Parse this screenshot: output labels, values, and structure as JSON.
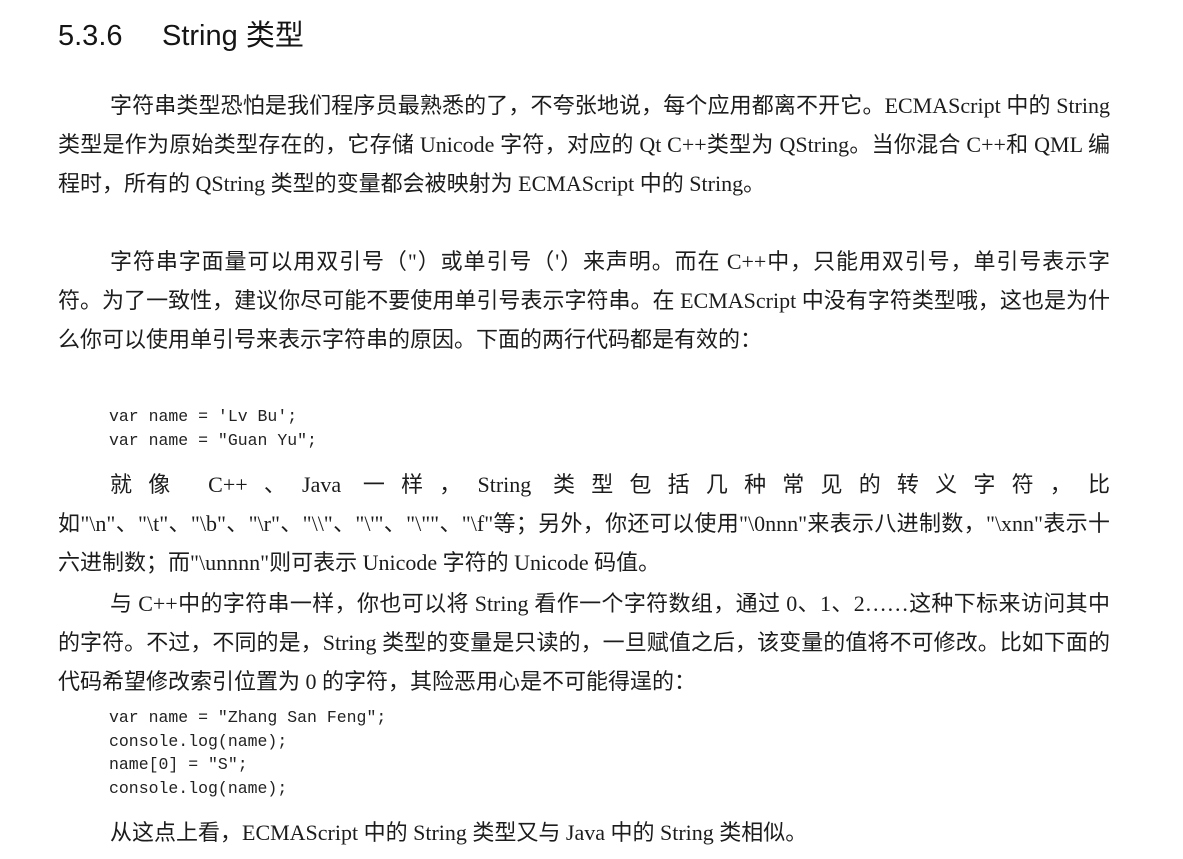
{
  "section": {
    "number": "5.3.6",
    "title": "String 类型"
  },
  "paragraphs": [
    "字符串类型恐怕是我们程序员最熟悉的了，不夸张地说，每个应用都离不开它。ECMAScript 中的 String 类型是作为原始类型存在的，它存储 Unicode 字符，对应的 Qt C++类型为 QString。当你混合 C++和 QML 编程时，所有的 QString 类型的变量都会被映射为 ECMAScript 中的 String。",
    "字符串字面量可以用双引号（\"）或单引号（'）来声明。而在 C++中，只能用双引号，单引号表示字符。为了一致性，建议你尽可能不要使用单引号表示字符串。在 ECMAScript 中没有字符类型哦，这也是为什么你可以使用单引号来表示字符串的原因。下面的两行代码都是有效的：",
    "就像 C++、Java 一样，String 类型包括几种常见的转义字符，比如\"\\n\"、\"\\t\"、\"\\b\"、\"\\r\"、\"\\\\\"、\"\\'\"、\"\\\"\"、\"\\f\"等；另外，你还可以使用\"\\0nnn\"来表示八进制数，\"\\xnn\"表示十六进制数；而\"\\unnnn\"则可表示 Unicode 字符的 Unicode 码值。",
    "与 C++中的字符串一样，你也可以将 String 看作一个字符数组，通过 0、1、2……这种下标来访问其中的字符。不过，不同的是，String 类型的变量是只读的，一旦赋值之后，该变量的值将不可修改。比如下面的代码希望修改索引位置为 0 的字符，其险恶用心是不可能得逞的：",
    "从这点上看，ECMAScript 中的 String 类型又与 Java 中的 String 类相似。"
  ],
  "code_blocks": [
    [
      "var name = 'Lv Bu';",
      "var name = \"Guan Yu\";"
    ],
    [
      "var name = \"Zhang San Feng\";",
      "console.log(name);",
      "name[0] = \"S\";",
      "console.log(name);"
    ]
  ]
}
